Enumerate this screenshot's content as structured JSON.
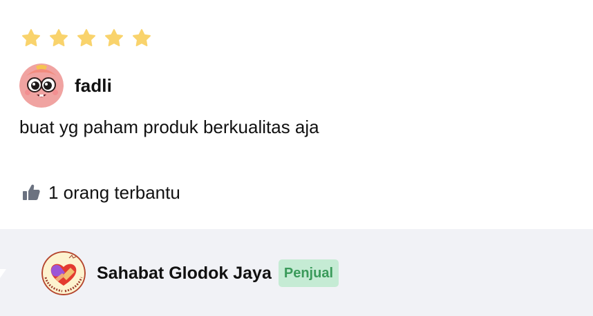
{
  "review": {
    "rating": 5,
    "max_rating": 5,
    "user_name": "fadli",
    "text": "buat yg paham produk berkualitas aja",
    "helpful_text": "1 orang terbantu"
  },
  "seller": {
    "name": "Sahabat Glodok Jaya",
    "badge": "Penjual",
    "logo_text": "www.pdsahabat.com"
  },
  "colors": {
    "star": "#f9d36c",
    "thumb": "#6b7280",
    "reply_background": "#f1f2f6",
    "badge_background": "#c5ebd4",
    "badge_text": "#3a9a5a"
  },
  "icons": {
    "star": "star-icon",
    "helpful": "thumbs-up-icon"
  }
}
